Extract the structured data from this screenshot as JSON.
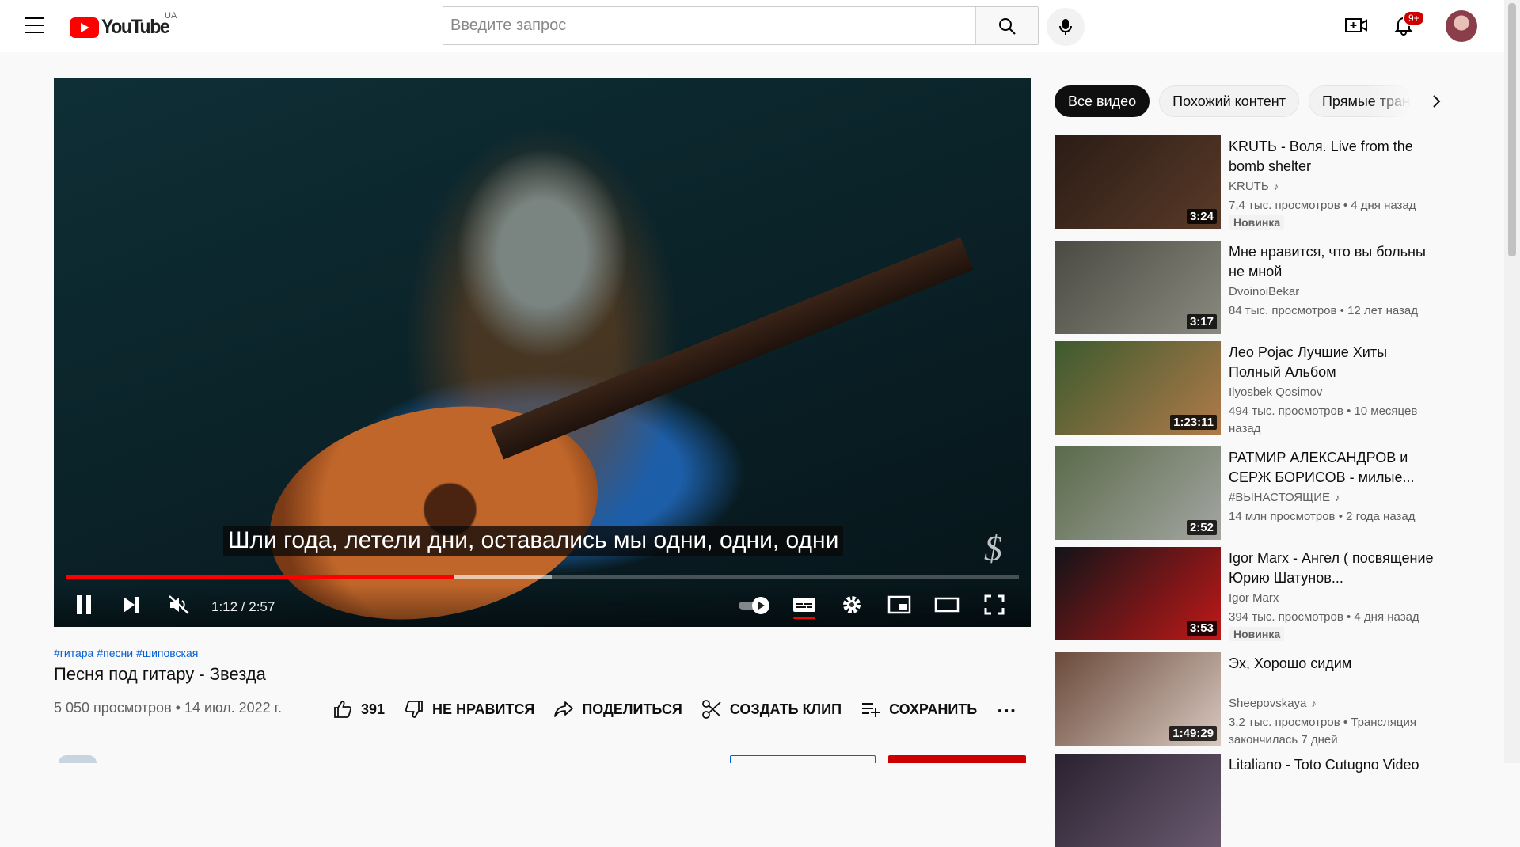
{
  "header": {
    "logo_text": "YouTube",
    "country": "UA",
    "search_placeholder": "Введите запрос",
    "notifications_count": "9+"
  },
  "player": {
    "subtitle": "Шли года, летели дни, оставались мы одни, одни, одни",
    "watermark": "$",
    "time_display": "1:12 / 2:57",
    "progress_played": 0.407,
    "progress_buffered": 0.51
  },
  "video": {
    "hashtags": [
      "#гитара",
      "#песни",
      "#шиповская"
    ],
    "title": "Песня под гитару - Звезда",
    "meta": "5 050 просмотров • 14 июл. 2022 г.",
    "likes": "391",
    "dislike_label": "НЕ НРАВИТСЯ",
    "share_label": "ПОДЕЛИТЬСЯ",
    "clip_label": "СОЗДАТЬ КЛИП",
    "save_label": "СОХРАНИТЬ"
  },
  "sidebar": {
    "chips": [
      "Все видео",
      "Похожий контент",
      "Прямые трансляции"
    ],
    "recommendations": [
      {
        "title": "KRUТЬ - Воля. Live from the bomb shelter",
        "channel": "KRUТЬ",
        "music": true,
        "stats": "7,4 тыс. просмотров • 4 дня назад",
        "duration": "3:24",
        "badge": "Новинка",
        "thumb_colors": [
          "#2a1c16",
          "#5a3a28"
        ]
      },
      {
        "title": "Мне нравится, что вы больны не мной",
        "channel": "DvoinoiBekar",
        "music": false,
        "stats": "84 тыс. просмотров • 12 лет назад",
        "duration": "3:17",
        "badge": "",
        "thumb_colors": [
          "#4b4a42",
          "#8a8a80"
        ]
      },
      {
        "title": "Лео Pojac Лучшие Хиты Полный Альбом",
        "channel": "Ilyosbek Qosimov",
        "music": false,
        "stats": "494 тыс. просмотров • 10 месяцев назад",
        "duration": "1:23:11",
        "badge": "",
        "thumb_colors": [
          "#3c5a2e",
          "#b07a4a"
        ]
      },
      {
        "title": "РАТМИР АЛЕКСАНДРОВ и СЕРЖ БОРИСОВ - милые...",
        "channel": "#ВЫНАСТОЯЩИЕ",
        "music": true,
        "stats": "14 млн просмотров • 2 года назад",
        "duration": "2:52",
        "badge": "",
        "thumb_colors": [
          "#5a6a4a",
          "#a4a6a2"
        ]
      },
      {
        "title": "Igor Marx - Ангел ( посвящение Юрию Шатунов...",
        "channel": "Igor Marx",
        "music": false,
        "stats": "394 тыс. просмотров • 4 дня назад",
        "duration": "3:53",
        "badge": "Новинка",
        "thumb_colors": [
          "#111418",
          "#c01818"
        ]
      },
      {
        "title": "Эх, Хорошо сидим",
        "channel": "Sheepovskaya",
        "music": true,
        "stats": "3,2 тыс. просмотров • Трансляция закончилась 7 дней",
        "duration": "1:49:29",
        "badge": "",
        "thumb_colors": [
          "#6a4a3a",
          "#d8c8c0"
        ]
      },
      {
        "title": "Litaliano - Toto Cutugno Video",
        "channel": "",
        "music": false,
        "stats": "",
        "duration": "",
        "badge": "",
        "thumb_colors": [
          "#2a2230",
          "#6a5a70"
        ]
      }
    ]
  }
}
